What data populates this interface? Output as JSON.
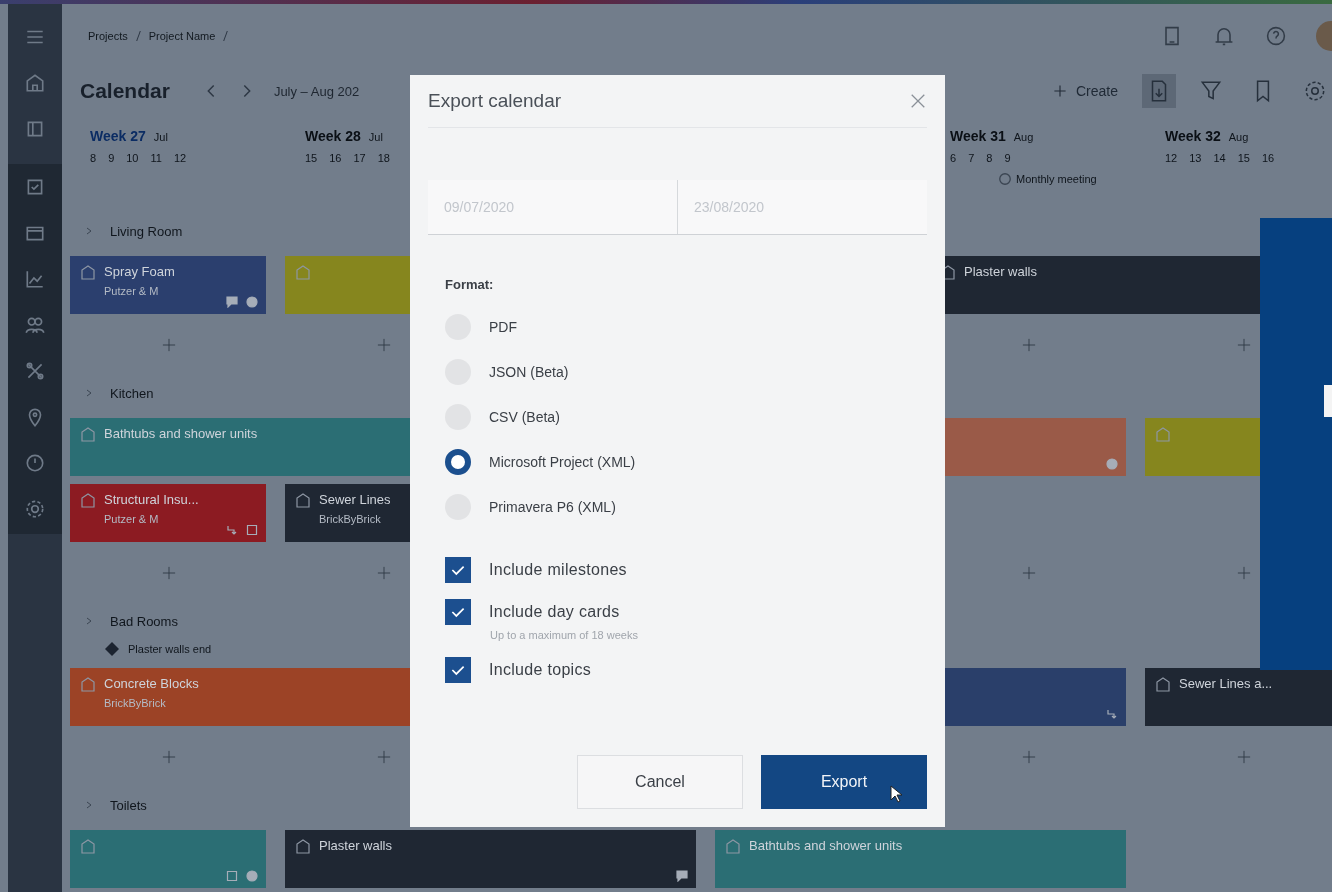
{
  "top_bar": {
    "breadcrumb": [
      "Projects",
      "Project Name"
    ]
  },
  "header": {
    "title": "Calendar",
    "range": "July – Aug 202",
    "create": "Create"
  },
  "weeks": [
    {
      "label": "Week 27",
      "month": "Jul",
      "current": true,
      "days": [
        "8",
        "9",
        "10",
        "11",
        "12"
      ]
    },
    {
      "label": "Week 28",
      "month": "Jul",
      "current": false,
      "days": [
        "15",
        "16",
        "17",
        "18"
      ]
    },
    {
      "label": "Week 31",
      "month": "Aug",
      "current": false,
      "days": [
        "6",
        "7",
        "8",
        "9"
      ],
      "event": "Monthly meeting"
    },
    {
      "label": "Week 32",
      "month": "Aug",
      "current": false,
      "days": [
        "12",
        "13",
        "14",
        "15",
        "16"
      ]
    }
  ],
  "lanes": [
    {
      "name": "Living Room",
      "rows": [
        [
          {
            "title": "Spray Foam",
            "subtitle": "Putzer & M",
            "color": "#2b3f6e",
            "badges": [
              {
                "kind": "comment"
              },
              {
                "kind": "alert"
              }
            ]
          },
          {
            "color": "#86861e"
          },
          {
            "title": "Plaster walls",
            "color": "#1f2733"
          }
        ]
      ]
    },
    {
      "name": "Kitchen",
      "rows": [
        [
          {
            "title": "Bathtubs and shower units",
            "color": "#2b6e74"
          },
          {
            "color": "#9a5a48",
            "badges": [
              {
                "kind": "alert"
              }
            ]
          },
          {
            "color": "#86861e"
          }
        ],
        [
          {
            "title": "Structural Insu...",
            "subtitle": "Putzer & M",
            "color": "#8c1b22",
            "badges": [
              {
                "kind": "link"
              },
              {
                "kind": "note"
              }
            ]
          },
          {
            "title": "Sewer Lines",
            "subtitle": "BrickByBrick",
            "color": "#1f2733"
          }
        ]
      ]
    },
    {
      "name": "Bad Rooms",
      "milestone": "Plaster walls end",
      "rows": [
        [
          {
            "title": "Concrete Blocks",
            "subtitle": "BrickByBrick",
            "color": "#9c4326"
          },
          {
            "color": "#2a3f6a",
            "badges": [
              {
                "kind": "link"
              }
            ]
          },
          {
            "title": "Sewer Lines a...",
            "color": "#1f2733"
          }
        ]
      ]
    },
    {
      "name": "Toilets",
      "rows": [
        [
          {
            "color": "#2b6e74",
            "badges": [
              {
                "kind": "note"
              },
              {
                "kind": "alert"
              }
            ]
          },
          {
            "title": "Plaster walls",
            "color": "#1f2733",
            "badges": [
              {
                "kind": "comment"
              }
            ]
          },
          {
            "title": "Bathtubs and shower units",
            "color": "#2b6e74"
          }
        ]
      ]
    }
  ],
  "dialog": {
    "title": "Export calendar",
    "date_fields": [
      {
        "value": "09/07/2020"
      },
      {
        "value": "23/08/2020"
      }
    ],
    "format_label": "Format:",
    "formats": [
      {
        "label": "PDF",
        "selected": false
      },
      {
        "label": "JSON (Beta)",
        "selected": false
      },
      {
        "label": "CSV (Beta)",
        "selected": false
      },
      {
        "label": "Microsoft Project (XML)",
        "selected": true
      },
      {
        "label": "Primavera P6 (XML)",
        "selected": false
      }
    ],
    "options": [
      {
        "label": "Include milestones",
        "checked": true
      },
      {
        "label": "Include day cards",
        "checked": true,
        "hint": "Up to a maximum of 18 weeks"
      },
      {
        "label": "Include topics",
        "checked": true
      }
    ],
    "buttons": [
      {
        "label": "Cancel",
        "kind": "secondary"
      },
      {
        "label": "Export",
        "kind": "primary"
      }
    ]
  }
}
